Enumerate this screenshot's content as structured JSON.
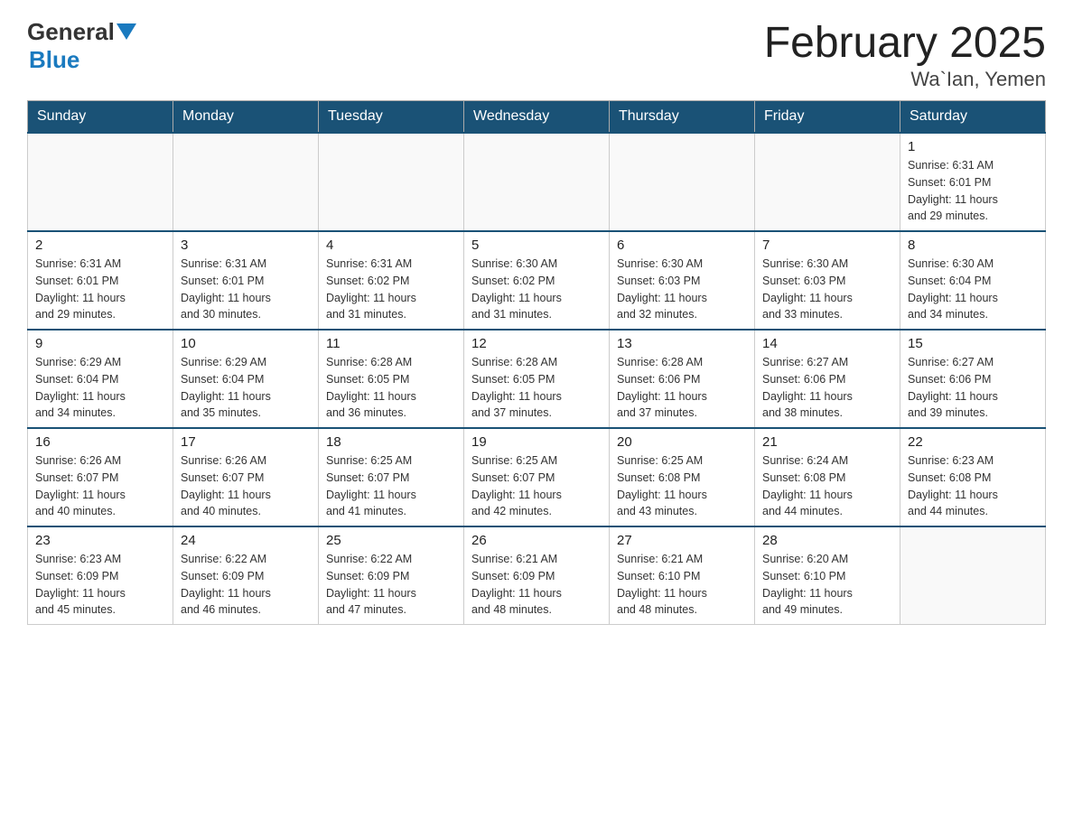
{
  "header": {
    "logo_general": "General",
    "logo_blue": "Blue",
    "title": "February 2025",
    "subtitle": "Wa`Ian, Yemen"
  },
  "days_of_week": [
    "Sunday",
    "Monday",
    "Tuesday",
    "Wednesday",
    "Thursday",
    "Friday",
    "Saturday"
  ],
  "weeks": [
    {
      "days": [
        {
          "number": "",
          "info": []
        },
        {
          "number": "",
          "info": []
        },
        {
          "number": "",
          "info": []
        },
        {
          "number": "",
          "info": []
        },
        {
          "number": "",
          "info": []
        },
        {
          "number": "",
          "info": []
        },
        {
          "number": "1",
          "info": [
            "Sunrise: 6:31 AM",
            "Sunset: 6:01 PM",
            "Daylight: 11 hours",
            "and 29 minutes."
          ]
        }
      ]
    },
    {
      "days": [
        {
          "number": "2",
          "info": [
            "Sunrise: 6:31 AM",
            "Sunset: 6:01 PM",
            "Daylight: 11 hours",
            "and 29 minutes."
          ]
        },
        {
          "number": "3",
          "info": [
            "Sunrise: 6:31 AM",
            "Sunset: 6:01 PM",
            "Daylight: 11 hours",
            "and 30 minutes."
          ]
        },
        {
          "number": "4",
          "info": [
            "Sunrise: 6:31 AM",
            "Sunset: 6:02 PM",
            "Daylight: 11 hours",
            "and 31 minutes."
          ]
        },
        {
          "number": "5",
          "info": [
            "Sunrise: 6:30 AM",
            "Sunset: 6:02 PM",
            "Daylight: 11 hours",
            "and 31 minutes."
          ]
        },
        {
          "number": "6",
          "info": [
            "Sunrise: 6:30 AM",
            "Sunset: 6:03 PM",
            "Daylight: 11 hours",
            "and 32 minutes."
          ]
        },
        {
          "number": "7",
          "info": [
            "Sunrise: 6:30 AM",
            "Sunset: 6:03 PM",
            "Daylight: 11 hours",
            "and 33 minutes."
          ]
        },
        {
          "number": "8",
          "info": [
            "Sunrise: 6:30 AM",
            "Sunset: 6:04 PM",
            "Daylight: 11 hours",
            "and 34 minutes."
          ]
        }
      ]
    },
    {
      "days": [
        {
          "number": "9",
          "info": [
            "Sunrise: 6:29 AM",
            "Sunset: 6:04 PM",
            "Daylight: 11 hours",
            "and 34 minutes."
          ]
        },
        {
          "number": "10",
          "info": [
            "Sunrise: 6:29 AM",
            "Sunset: 6:04 PM",
            "Daylight: 11 hours",
            "and 35 minutes."
          ]
        },
        {
          "number": "11",
          "info": [
            "Sunrise: 6:28 AM",
            "Sunset: 6:05 PM",
            "Daylight: 11 hours",
            "and 36 minutes."
          ]
        },
        {
          "number": "12",
          "info": [
            "Sunrise: 6:28 AM",
            "Sunset: 6:05 PM",
            "Daylight: 11 hours",
            "and 37 minutes."
          ]
        },
        {
          "number": "13",
          "info": [
            "Sunrise: 6:28 AM",
            "Sunset: 6:06 PM",
            "Daylight: 11 hours",
            "and 37 minutes."
          ]
        },
        {
          "number": "14",
          "info": [
            "Sunrise: 6:27 AM",
            "Sunset: 6:06 PM",
            "Daylight: 11 hours",
            "and 38 minutes."
          ]
        },
        {
          "number": "15",
          "info": [
            "Sunrise: 6:27 AM",
            "Sunset: 6:06 PM",
            "Daylight: 11 hours",
            "and 39 minutes."
          ]
        }
      ]
    },
    {
      "days": [
        {
          "number": "16",
          "info": [
            "Sunrise: 6:26 AM",
            "Sunset: 6:07 PM",
            "Daylight: 11 hours",
            "and 40 minutes."
          ]
        },
        {
          "number": "17",
          "info": [
            "Sunrise: 6:26 AM",
            "Sunset: 6:07 PM",
            "Daylight: 11 hours",
            "and 40 minutes."
          ]
        },
        {
          "number": "18",
          "info": [
            "Sunrise: 6:25 AM",
            "Sunset: 6:07 PM",
            "Daylight: 11 hours",
            "and 41 minutes."
          ]
        },
        {
          "number": "19",
          "info": [
            "Sunrise: 6:25 AM",
            "Sunset: 6:07 PM",
            "Daylight: 11 hours",
            "and 42 minutes."
          ]
        },
        {
          "number": "20",
          "info": [
            "Sunrise: 6:25 AM",
            "Sunset: 6:08 PM",
            "Daylight: 11 hours",
            "and 43 minutes."
          ]
        },
        {
          "number": "21",
          "info": [
            "Sunrise: 6:24 AM",
            "Sunset: 6:08 PM",
            "Daylight: 11 hours",
            "and 44 minutes."
          ]
        },
        {
          "number": "22",
          "info": [
            "Sunrise: 6:23 AM",
            "Sunset: 6:08 PM",
            "Daylight: 11 hours",
            "and 44 minutes."
          ]
        }
      ]
    },
    {
      "days": [
        {
          "number": "23",
          "info": [
            "Sunrise: 6:23 AM",
            "Sunset: 6:09 PM",
            "Daylight: 11 hours",
            "and 45 minutes."
          ]
        },
        {
          "number": "24",
          "info": [
            "Sunrise: 6:22 AM",
            "Sunset: 6:09 PM",
            "Daylight: 11 hours",
            "and 46 minutes."
          ]
        },
        {
          "number": "25",
          "info": [
            "Sunrise: 6:22 AM",
            "Sunset: 6:09 PM",
            "Daylight: 11 hours",
            "and 47 minutes."
          ]
        },
        {
          "number": "26",
          "info": [
            "Sunrise: 6:21 AM",
            "Sunset: 6:09 PM",
            "Daylight: 11 hours",
            "and 48 minutes."
          ]
        },
        {
          "number": "27",
          "info": [
            "Sunrise: 6:21 AM",
            "Sunset: 6:10 PM",
            "Daylight: 11 hours",
            "and 48 minutes."
          ]
        },
        {
          "number": "28",
          "info": [
            "Sunrise: 6:20 AM",
            "Sunset: 6:10 PM",
            "Daylight: 11 hours",
            "and 49 minutes."
          ]
        },
        {
          "number": "",
          "info": []
        }
      ]
    }
  ]
}
